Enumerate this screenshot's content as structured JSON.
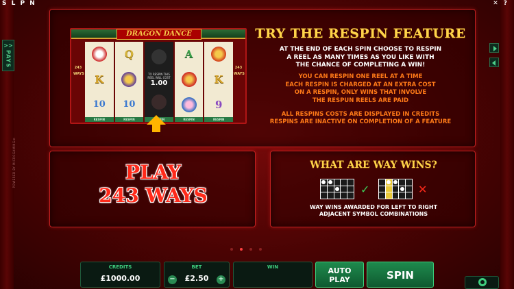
{
  "app": {
    "brand_letters": "S L P N",
    "icons": {
      "close": "✕",
      "help": "?"
    }
  },
  "side_tab": {
    "arrows": ">>",
    "label": "PAYS"
  },
  "credit_line": "POWERED BY MICROGAMING®",
  "respin": {
    "game_title": "DRAGON DANCE",
    "ways_tag": "243 WAYS",
    "reels": [
      {
        "symbols": [
          "lion-dancer",
          "K",
          "10"
        ],
        "button": "RESPIN"
      },
      {
        "symbols": [
          "Q",
          "drummer",
          "10"
        ],
        "button": "RESPIN"
      },
      {
        "symbols": [],
        "overlay_text": "TO RESPIN THIS REEL WILL COST",
        "cost": "1.00",
        "button": "RESPIN"
      },
      {
        "symbols": [
          "A",
          "firecrackers",
          "drummer-girl"
        ],
        "button": "RESPIN"
      },
      {
        "symbols": [
          "dragon",
          "K",
          "9"
        ],
        "button": "RESPIN"
      }
    ],
    "heading": "TRY THE RESPIN FEATURE",
    "description": [
      "AT THE END OF EACH SPIN CHOOSE TO RESPIN",
      "A REEL AS MANY TIMES AS YOU LIKE WITH",
      "THE CHANCE OF COMPLETING A WIN!"
    ],
    "notes": [
      "YOU CAN RESPIN ONE REEL AT A TIME",
      "EACH RESPIN IS CHARGED AT AN EXTRA COST",
      "ON A RESPIN, ONLY WINS THAT INVOLVE",
      "THE RESPUN REELS ARE PAID"
    ],
    "notes2": [
      "ALL RESPINS COSTS ARE DISPLAYED IN CREDITS",
      "RESPINS ARE INACTIVE ON COMPLETION OF A FEATURE"
    ]
  },
  "ways": {
    "line1": "PLAY",
    "line2": "243 WAYS"
  },
  "way_wins": {
    "title": "WHAT ARE WAY WINS?",
    "note_line1": "WAY WINS AWARDED FOR LEFT TO RIGHT",
    "note_line2": "ADJACENT SYMBOL COMBINATIONS",
    "check": "✓",
    "cross": "✕"
  },
  "pagination": {
    "total": 4,
    "active": 2
  },
  "bottom": {
    "credits_label": "CREDITS",
    "credits_value": "£1000.00",
    "bet_label": "BET",
    "bet_value": "£2.50",
    "win_label": "WIN",
    "win_value": "",
    "auto_play_line1": "AUTO",
    "auto_play_line2": "PLAY",
    "spin_label": "SPIN"
  },
  "colors": {
    "accent_gold": "#ffd44a",
    "accent_orange": "#ff7a18",
    "accent_green": "#3fcf7f",
    "play_red": "#ff2a1a"
  }
}
